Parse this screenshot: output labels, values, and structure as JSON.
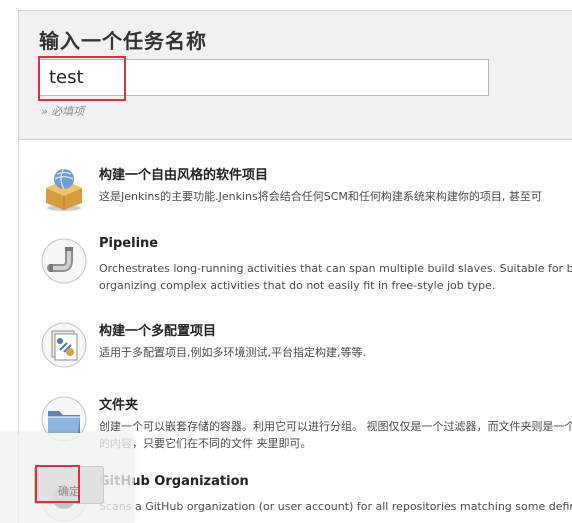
{
  "header": {
    "title": "输入一个任务名称",
    "item_name_value": "test",
    "required_hint": "» 必填项"
  },
  "items": [
    {
      "title": "构建一个自由风格的软件项目",
      "description": "这是Jenkins的主要功能.Jenkins将会结合任何SCM和任何构建系统来构建你的项目, 甚至可",
      "icon": "freestyle-project-icon"
    },
    {
      "title": "Pipeline",
      "description": "Orchestrates long-running activities that can span multiple build slaves. Suitable for building pipelines (formerly known as workflows) and/or",
      "description2": "organizing complex activities that do not easily fit in free-style job type.",
      "icon": "pipeline-icon"
    },
    {
      "title": "构建一个多配置项目",
      "description": "适用于多配置项目,例如多环境测试,平台指定构建,等等.",
      "icon": "multi-config-project-icon"
    },
    {
      "title": "文件夹",
      "description": "创建一个可以嵌套存储的容器。利用它可以进行分组。 视图仅仅是一个过滤器，而文件夹则是一个独立的命名空间，",
      "description2": "的内容，只要它们在不同的文件 夹里即可。",
      "icon": "folder-icon"
    },
    {
      "title": "GitHub Organization",
      "description": "Scans a GitHub organization (or user account) for all repositories matching some defined markers.",
      "icon": "github-organization-icon"
    }
  ],
  "footer": {
    "ok_label": "确定"
  },
  "colors": {
    "highlight": "#d9343d",
    "header_background": "#f1f1f1"
  }
}
